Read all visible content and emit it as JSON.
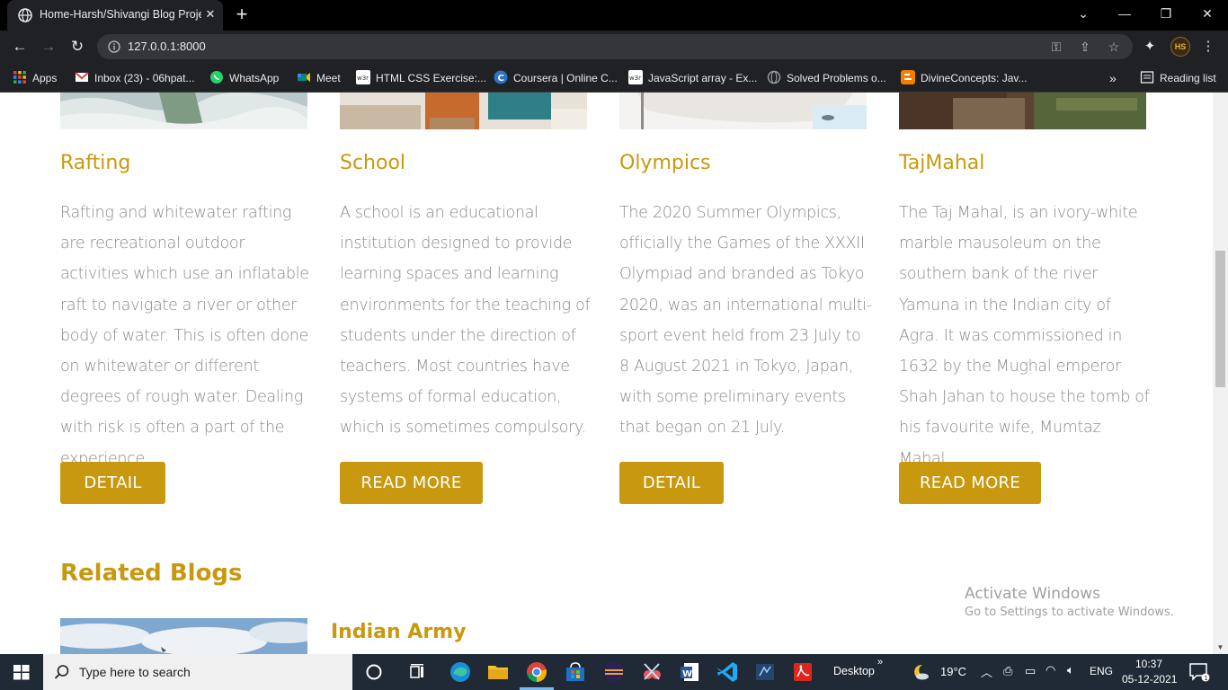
{
  "browser": {
    "tab_title": "Home-Harsh/Shivangi Blog Proje",
    "url": "127.0.0.1:8000",
    "reading_list": "Reading list",
    "bookmarks": [
      {
        "label": "Apps",
        "icon": "apps-grid-icon",
        "color": "#ea4335"
      },
      {
        "label": "Inbox (23) - 06hpat...",
        "icon": "gmail-icon",
        "color": "#ea4335"
      },
      {
        "label": "WhatsApp",
        "icon": "whatsapp-icon",
        "color": "#25d366"
      },
      {
        "label": "Meet",
        "icon": "meet-icon",
        "color": "#00897b"
      },
      {
        "label": "HTML CSS Exercise:...",
        "icon": "w3r-icon",
        "color": "#ffffff"
      },
      {
        "label": "Coursera | Online C...",
        "icon": "coursera-icon",
        "color": "#2a73cc"
      },
      {
        "label": "JavaScript array - Ex...",
        "icon": "w3r-icon",
        "color": "#ffffff"
      },
      {
        "label": "Solved Problems o...",
        "icon": "globe-icon",
        "color": "#9aa0a6"
      },
      {
        "label": "DivineConcepts: Jav...",
        "icon": "blogger-icon",
        "color": "#f57d00"
      }
    ]
  },
  "cards": [
    {
      "title": "Rafting",
      "text": "Rafting and whitewater rafting are recreational outdoor activities which use an inflatable raft to navigate a river or other body of water. This is often done on whitewater or different degrees of rough water. Dealing with risk is often a part of the experience.",
      "button": "DETAIL"
    },
    {
      "title": "School",
      "text": "A school is an educational institution designed to provide learning spaces and learning environments for the teaching of students under the direction of teachers. Most countries have systems of formal education, which is sometimes compulsory.",
      "button": "READ MORE"
    },
    {
      "title": "Olympics",
      "text": "The 2020 Summer Olympics, officially the Games of the XXXII Olympiad and branded as Tokyo 2020, was an international multi-sport event held from 23 July to 8 August 2021 in Tokyo, Japan, with some preliminary events that began on 21 July.",
      "button": "DETAIL"
    },
    {
      "title": "TajMahal",
      "text": "The Taj Mahal, is an ivory-white marble mausoleum on the southern bank of the river Yamuna in the Indian city of Agra. It was commissioned in 1632 by the Mughal emperor Shah Jahan to house the tomb of his favourite wife, Mumtaz Mahal.",
      "button": "READ MORE"
    }
  ],
  "related": {
    "heading": "Related Blogs",
    "first_item_title": "Indian Army"
  },
  "watermark": {
    "line1": "Activate Windows",
    "line2": "Go to Settings to activate Windows."
  },
  "taskbar": {
    "search_placeholder": "Type here to search",
    "desktop_label": "Desktop",
    "temperature": "19°C",
    "language": "ENG",
    "time": "10:37",
    "date": "05-12-2021",
    "notification_count": "1"
  },
  "colors": {
    "accent": "#c8990f",
    "body_text": "#8a8a8a"
  }
}
